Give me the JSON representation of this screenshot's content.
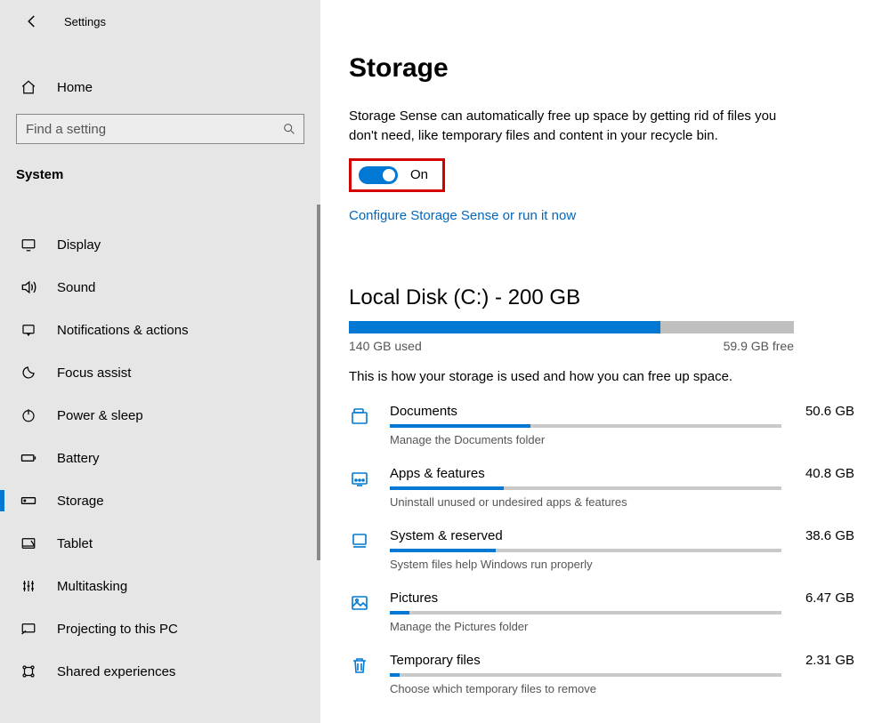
{
  "header": {
    "app_title": "Settings",
    "home_label": "Home",
    "search_placeholder": "Find a setting",
    "group_label": "System"
  },
  "sidebar_items": [
    {
      "key": "display",
      "label": "Display",
      "active": false
    },
    {
      "key": "sound",
      "label": "Sound",
      "active": false
    },
    {
      "key": "notifications",
      "label": "Notifications & actions",
      "active": false
    },
    {
      "key": "focus",
      "label": "Focus assist",
      "active": false
    },
    {
      "key": "power",
      "label": "Power & sleep",
      "active": false
    },
    {
      "key": "battery",
      "label": "Battery",
      "active": false
    },
    {
      "key": "storage",
      "label": "Storage",
      "active": true
    },
    {
      "key": "tablet",
      "label": "Tablet",
      "active": false
    },
    {
      "key": "multitasking",
      "label": "Multitasking",
      "active": false
    },
    {
      "key": "projecting",
      "label": "Projecting to this PC",
      "active": false
    },
    {
      "key": "shared",
      "label": "Shared experiences",
      "active": false
    }
  ],
  "page": {
    "title": "Storage",
    "sense_desc": "Storage Sense can automatically free up space by getting rid of files you don't need, like temporary files and content in your recycle bin.",
    "toggle_state_label": "On",
    "toggle_on": true,
    "config_link": "Configure Storage Sense or run it now"
  },
  "disk": {
    "title": "Local Disk (C:) - 200 GB",
    "used_label": "140 GB used",
    "free_label": "59.9 GB free",
    "used_pct": 70,
    "description": "This is how your storage is used and how you can free up space."
  },
  "categories": [
    {
      "key": "documents",
      "name": "Documents",
      "size": "50.6 GB",
      "pct": 36,
      "sub": "Manage the Documents folder"
    },
    {
      "key": "apps",
      "name": "Apps & features",
      "size": "40.8 GB",
      "pct": 29,
      "sub": "Uninstall unused or undesired apps & features"
    },
    {
      "key": "system",
      "name": "System & reserved",
      "size": "38.6 GB",
      "pct": 27,
      "sub": "System files help Windows run properly"
    },
    {
      "key": "pictures",
      "name": "Pictures",
      "size": "6.47 GB",
      "pct": 5,
      "sub": "Manage the Pictures folder"
    },
    {
      "key": "temp",
      "name": "Temporary files",
      "size": "2.31 GB",
      "pct": 2.5,
      "sub": "Choose which temporary files to remove"
    }
  ]
}
